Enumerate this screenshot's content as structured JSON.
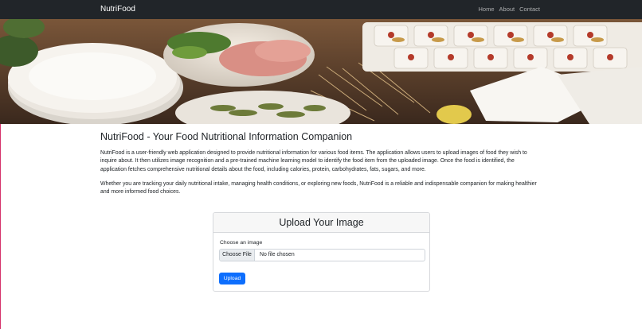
{
  "navbar": {
    "brand": "NutriFood",
    "links": [
      {
        "label": "Home"
      },
      {
        "label": "About"
      },
      {
        "label": "Contact"
      }
    ]
  },
  "main": {
    "title": "NutriFood - Your Food Nutritional Information Companion",
    "paragraphs": [
      "NutriFood is a user-friendly web application designed to provide nutritional information for various food items. The application allows users to upload images of food they wish to inquire about. It then utilizes image recognition and a pre-trained machine learning model to identify the food item from the uploaded image. Once the food is identified, the application fetches comprehensive nutritional details about the food, including calories, protein, carbohydrates, fats, sugars, and more.",
      "Whether you are tracking your daily nutritional intake, managing health conditions, or exploring new foods, NutriFood is a reliable and indispensable companion for making healthier and more informed food choices."
    ]
  },
  "upload": {
    "header": "Upload Your Image",
    "label": "Choose an image",
    "file_button": "Choose File",
    "file_status": "No file chosen",
    "submit": "Upload"
  },
  "colors": {
    "navbar_bg": "#212529",
    "primary": "#0d6efd"
  }
}
